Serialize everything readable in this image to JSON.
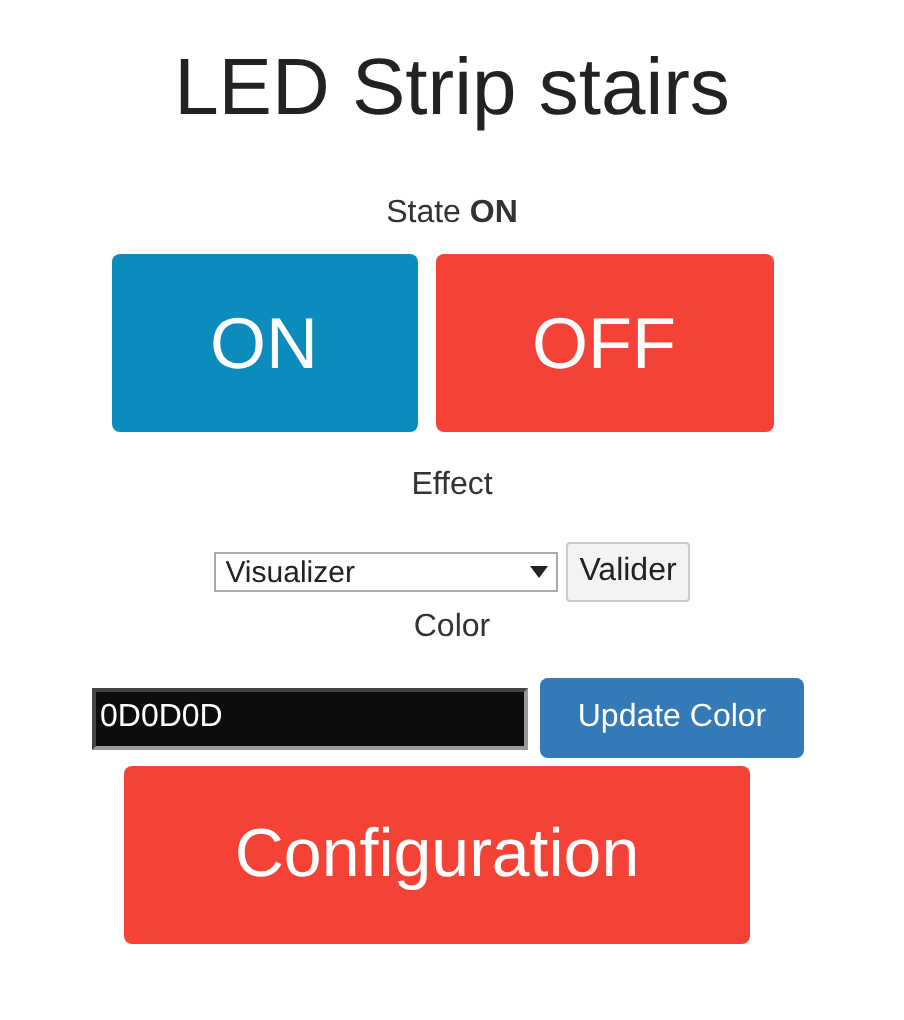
{
  "title": "LED Strip stairs",
  "state": "State **ON**",
  "power_buttons": [
    {
      "label": "ON",
      "kind": "primary"
    },
    {
      "label": "OFF",
      "kind": "danger"
    }
  ],
  "effect": {
    "label": "Effect",
    "value": "Visualizer",
    "button": "Valider"
  },
  "color": {
    "label": "Color",
    "value": "0D0D0D",
    "button": "Update Color"
  },
  "config_button": {
    "label": "Configuration",
    "kind": "danger"
  }
}
